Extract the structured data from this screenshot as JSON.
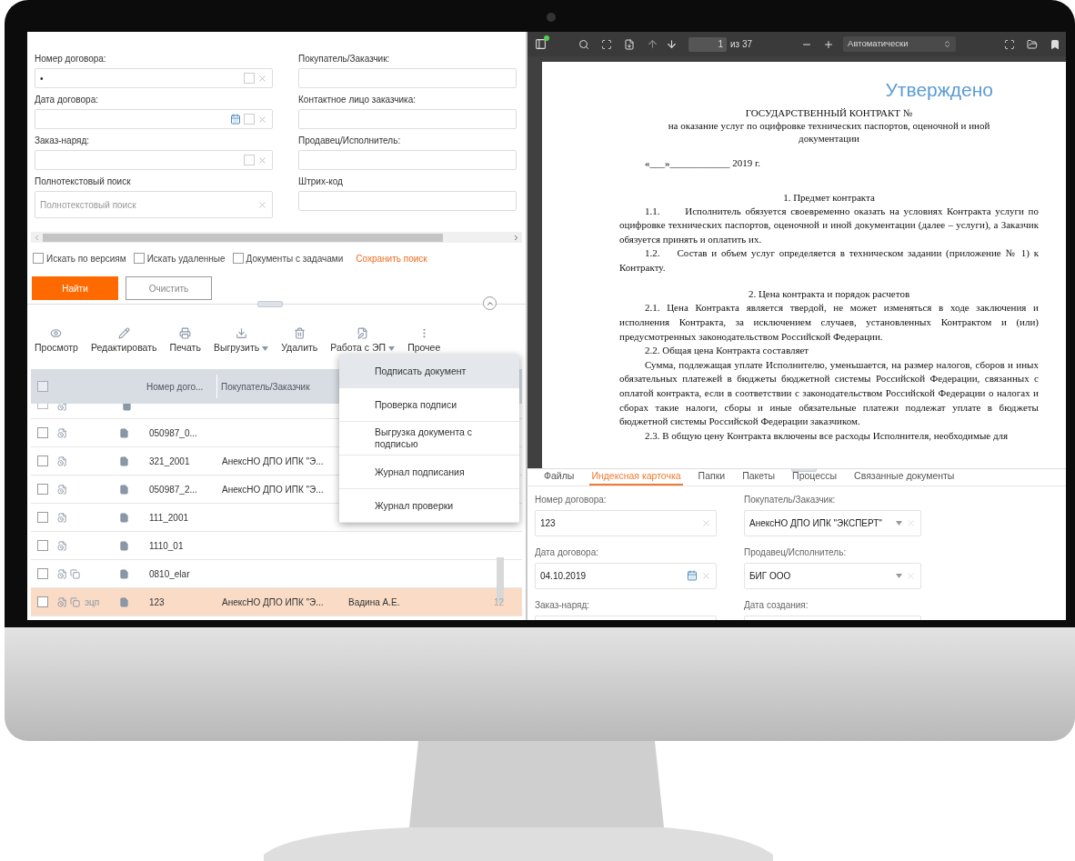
{
  "search_form": {
    "left_fields": [
      {
        "label": "Номер договора:",
        "value": "•",
        "kind": "text",
        "checked": false
      },
      {
        "label": "Дата договора:",
        "kind": "date",
        "checked": false
      },
      {
        "label": "Заказ-наряд:",
        "kind": "text",
        "checked": false
      },
      {
        "label": "Полнотекстовый поиск",
        "placeholder": "Полнотекстовый поиск",
        "kind": "search"
      }
    ],
    "right_fields": [
      {
        "label": "Покупатель/Заказчик:",
        "kind": "plain"
      },
      {
        "label": "Контактное лицо заказчика:",
        "kind": "plain"
      },
      {
        "label": "Продавец/Исполнитель:",
        "kind": "plain"
      },
      {
        "label": "Штрих-код",
        "kind": "plain"
      }
    ],
    "options": [
      {
        "label": "Искать по версиям",
        "checked": false
      },
      {
        "label": "Искать удаленные",
        "checked": false
      },
      {
        "label": "Документы с задачами",
        "checked": false
      }
    ],
    "save_link": "Сохранить поиск",
    "buttons": [
      {
        "label": "Найти",
        "kind": "primary"
      },
      {
        "label": "Очистить",
        "kind": "secondary"
      }
    ]
  },
  "toolbar": [
    {
      "label": "Просмотр",
      "kind": "view",
      "dropdown": false
    },
    {
      "label": "Редактировать",
      "kind": "edit",
      "dropdown": false
    },
    {
      "label": "Печать",
      "kind": "print",
      "dropdown": false
    },
    {
      "label": "Выгрузить",
      "kind": "download",
      "dropdown": true
    },
    {
      "label": "Удалить",
      "kind": "delete",
      "dropdown": false
    },
    {
      "label": "Работа с ЭП",
      "kind": "sign",
      "dropdown": true
    },
    {
      "label": "Прочее",
      "kind": "more",
      "dropdown": false
    }
  ],
  "table": {
    "columns": [
      "Номер дого...",
      "Покупатель/Заказчик"
    ],
    "all_checked": false,
    "rows": [
      {
        "number": "050987_0...",
        "selected": false,
        "copies": false
      },
      {
        "number": "321_2001",
        "customer": "АнексНО ДПО ИПК \"Э...",
        "selected": false,
        "copies": false
      },
      {
        "number": "050987_2...",
        "customer": "АнексНО ДПО ИПК \"Э...",
        "selected": false,
        "copies": false
      },
      {
        "number": "111_2001",
        "selected": false,
        "copies": false
      },
      {
        "number": "1110_01",
        "selected": false,
        "copies": false
      },
      {
        "number": "0810_elar",
        "selected": false,
        "copies": true
      },
      {
        "tag": "эцп",
        "number": "123",
        "customer": "АнексНО ДПО ИПК \"Э...",
        "person": "Вадина А.Е.",
        "extra": "12",
        "selected": true,
        "copies": true
      }
    ]
  },
  "menu": [
    {
      "label": "Подписать документ",
      "selected": true
    },
    {
      "label": "Проверка подписи",
      "selected": false
    },
    {
      "label": "Выгрузка документа с подписью",
      "selected": false
    },
    {
      "label": "Журнал подписания",
      "selected": false
    },
    {
      "label": "Журнал проверки",
      "selected": false
    }
  ],
  "viewer": {
    "page": "1",
    "page_count": "из 37",
    "zoom": "Автоматически",
    "document": {
      "stamp": "Утверждено",
      "title": "ГОСУДАРСТВЕННЫЙ КОНТРАКТ №",
      "subtitle": "на оказание услуг по оцифровке технических паспортов, оценочной и иной документации",
      "date_line": "«___»____________ 2019 г.",
      "paragraphs": [
        {
          "kind": "heading",
          "text": "1. Предмет контракта"
        },
        {
          "kind": "para",
          "text": "1.1.      Исполнитель обязуется своевременно оказать на условиях Контракта услуги по оцифровке технических паспортов, оценочной и иной документации (далее – услуги), а Заказчик обязуется принять и оплатить их."
        },
        {
          "kind": "para",
          "text": "1.2.    Состав и объем услуг определяется в техническом задании (приложение № 1) к Контракту."
        },
        {
          "kind": "heading",
          "text": "2. Цена контракта и порядок расчетов"
        },
        {
          "kind": "para",
          "text": "2.1. Цена Контракта является твердой, не может изменяться в ходе заключения и исполнения Контракта, за исключением случаев, установленных Контрактом и (или) предусмотренных законодательством Российской Федерации."
        },
        {
          "kind": "para",
          "text": "2.2. Общая цена Контракта составляет"
        },
        {
          "kind": "para",
          "text": "Сумма, подлежащая уплате Исполнителю, уменьшается, на размер налогов, сборов и иных обязательных платежей в бюджеты бюджетной системы Российской Федерации, связанных с оплатой контракта, если в соответствии с законодательством Российской Федерации о налогах и сборах такие налоги, сборы и иные обязательные платежи подлежат уплате в бюджеты бюджетной системы Российской Федерации заказчиком."
        },
        {
          "kind": "para",
          "text": "2.3. В общую цену Контракта включены все расходы Исполнителя, необходимые для"
        }
      ]
    }
  },
  "card": {
    "tabs": [
      {
        "label": "Файлы",
        "selected": false
      },
      {
        "label": "Индексная карточка",
        "selected": true
      },
      {
        "label": "Папки",
        "selected": false
      },
      {
        "label": "Пакеты",
        "selected": false
      },
      {
        "label": "Процессы",
        "selected": false
      },
      {
        "label": "Связанные документы",
        "selected": false
      }
    ],
    "left_fields": [
      {
        "label": "Номер договора:",
        "value": "123",
        "kind": "text"
      },
      {
        "label": "Дата договора:",
        "value": "04.10.2019",
        "kind": "date"
      },
      {
        "label": "Заказ-наряд:",
        "kind": "text"
      }
    ],
    "right_fields": [
      {
        "label": "Покупатель/Заказчик:",
        "value": "АнексНО ДПО ИПК \"ЭКСПЕРТ\"",
        "kind": "select"
      },
      {
        "label": "Продавец/Исполнитель:",
        "value": "БИГ ООО",
        "kind": "select"
      },
      {
        "label": "Дата создания:",
        "kind": "select"
      }
    ]
  }
}
